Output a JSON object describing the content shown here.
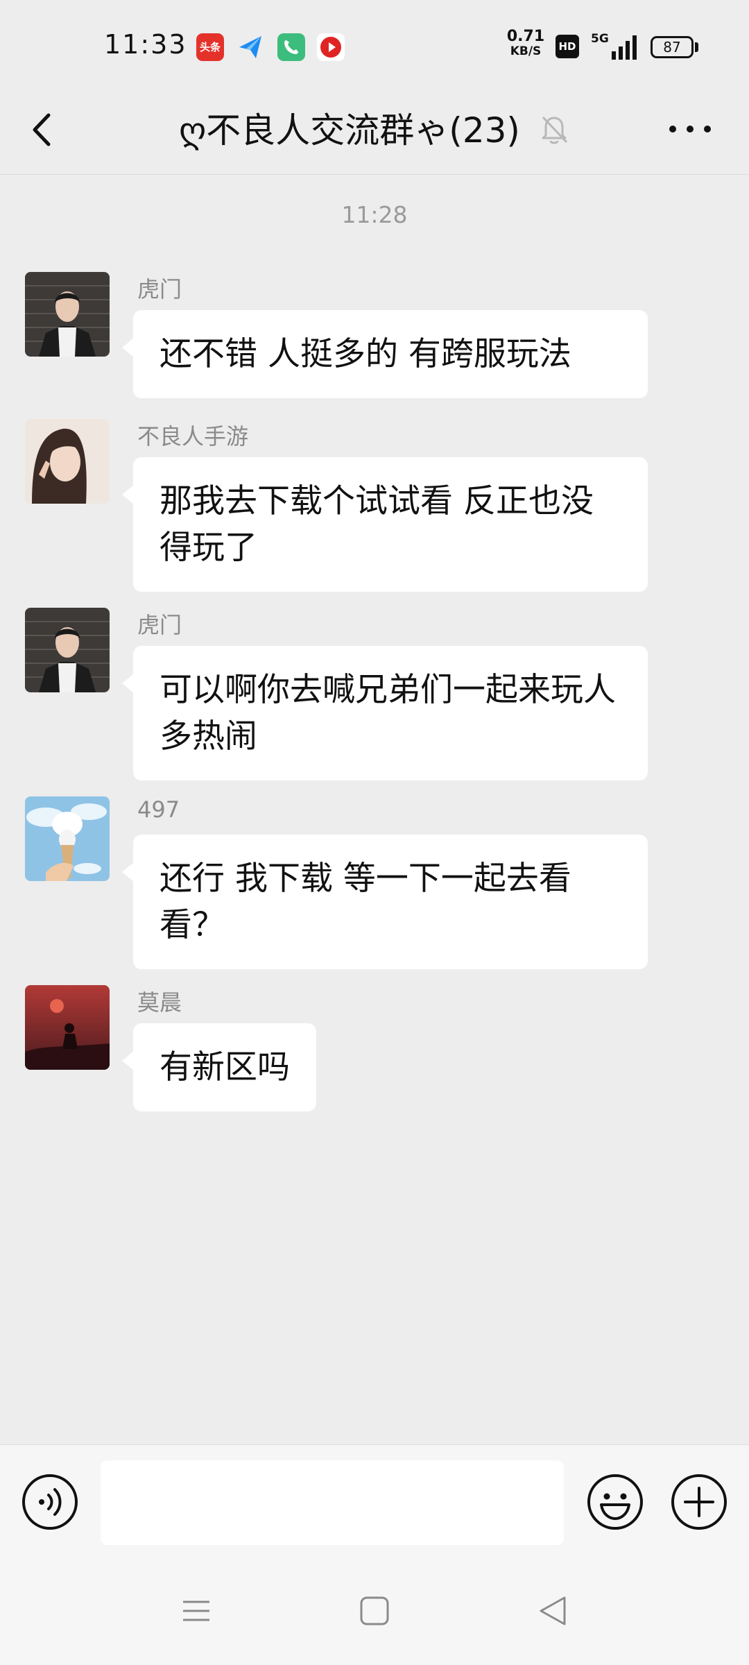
{
  "status_bar": {
    "time": "11:33",
    "app_icons": [
      "toutiao-icon",
      "send-icon",
      "phone-icon",
      "video-icon"
    ],
    "toutiao_label": "头条",
    "net_speed_value": "0.71",
    "net_speed_unit": "KB/S",
    "hd_label": "HD",
    "network_label": "5G",
    "battery": "87"
  },
  "header": {
    "title": "ღ不良人交流群ゃ(23)"
  },
  "chat": {
    "timestamp": "11:28",
    "messages": [
      {
        "sender": "虎门",
        "text": "还不错 人挺多的 有跨服玩法"
      },
      {
        "sender": "不良人手游",
        "text": "那我去下载个试试看 反正也没得玩了"
      },
      {
        "sender": "虎门",
        "text": "可以啊你去喊兄弟们一起来玩人多热闹"
      },
      {
        "sender": "497",
        "text": "还行 我下载 等一下一起去看看？"
      },
      {
        "sender": "莫晨",
        "text": "有新区吗"
      }
    ]
  },
  "input": {
    "placeholder": ""
  },
  "colors": {
    "background": "#ededed",
    "bubble": "#ffffff",
    "sender_text": "#8a8a8a",
    "timestamp_text": "#9a9a9a",
    "toutiao_red": "#e4322b",
    "phone_green": "#3dbd7d"
  }
}
